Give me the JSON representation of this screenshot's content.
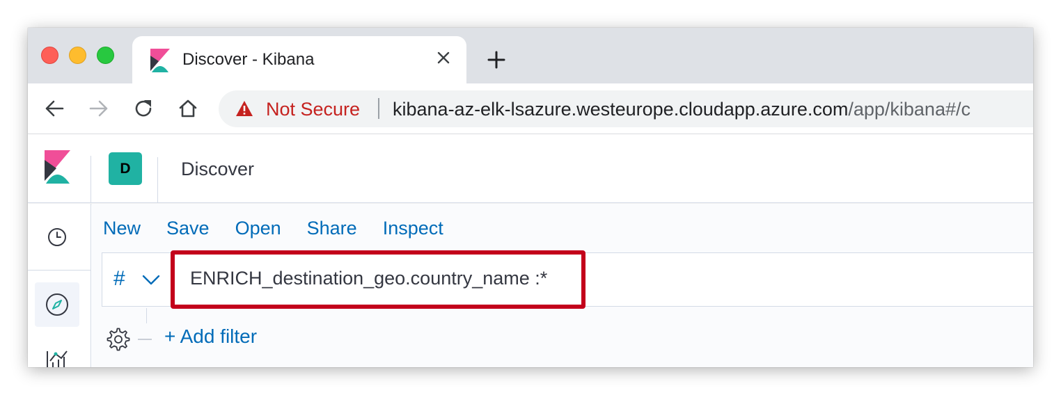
{
  "browser": {
    "tab": {
      "title": "Discover - Kibana",
      "favicon": "kibana-logo-icon"
    },
    "new_tab_icon": "plus-icon",
    "omnibox": {
      "security_label": "Not Secure",
      "security_icon": "warning-triangle-icon",
      "url_host": "kibana-az-elk-lsazure.westeurope.cloudapp.azure.com",
      "url_path": "/app/kibana#/c"
    },
    "colors": {
      "not_secure": "#c5221f",
      "tabstrip": "#dee1e6"
    }
  },
  "kibana": {
    "space_avatar_letter": "D",
    "page_title": "Discover",
    "top_nav": [
      "New",
      "Save",
      "Open",
      "Share",
      "Inspect"
    ],
    "query": {
      "language_symbol": "#",
      "value": "ENRICH_destination_geo.country_name :*"
    },
    "add_filter_label": "+ Add filter",
    "colors": {
      "link": "#006bb8",
      "highlight_border": "#c3001b",
      "space_avatar": "#20b2a3"
    }
  }
}
